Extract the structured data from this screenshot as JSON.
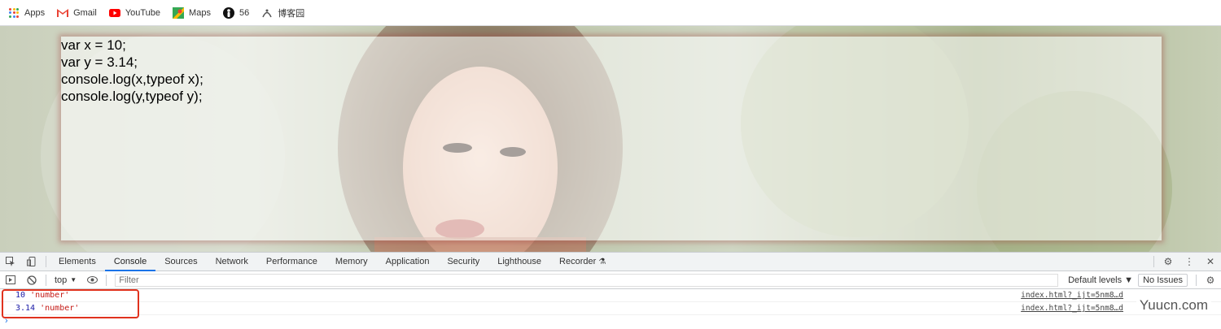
{
  "bookmarks": [
    {
      "label": "Apps",
      "icon": "apps-grid-icon"
    },
    {
      "label": "Gmail",
      "icon": "gmail-icon"
    },
    {
      "label": "YouTube",
      "icon": "youtube-icon"
    },
    {
      "label": "Maps",
      "icon": "maps-icon"
    },
    {
      "label": "56",
      "icon": "person-icon"
    },
    {
      "label": "博客园",
      "icon": "cnblogs-icon"
    }
  ],
  "page": {
    "code_lines": [
      "var x = 10;",
      "var y = 3.14;",
      "console.log(x,typeof x);",
      "console.log(y,typeof y);"
    ]
  },
  "devtools": {
    "tabs": [
      "Elements",
      "Console",
      "Sources",
      "Network",
      "Performance",
      "Memory",
      "Application",
      "Security",
      "Lighthouse",
      "Recorder"
    ],
    "active_tab": "Console",
    "context": "top",
    "filter_placeholder": "Filter",
    "levels": "Default levels ▼",
    "issues": "No Issues",
    "logs": [
      {
        "value": "10",
        "type": "'number'",
        "source": "index.html?_ijt=5nm8…d"
      },
      {
        "value": "3.14",
        "type": "'number'",
        "source": "index.html?_ijt=5nm8…d"
      }
    ]
  },
  "watermark": "Yuucn.com",
  "colors": {
    "accent": "#1a73e8",
    "highlight": "#e0321e",
    "number": "#1a1aa6",
    "string": "#c41a16"
  }
}
